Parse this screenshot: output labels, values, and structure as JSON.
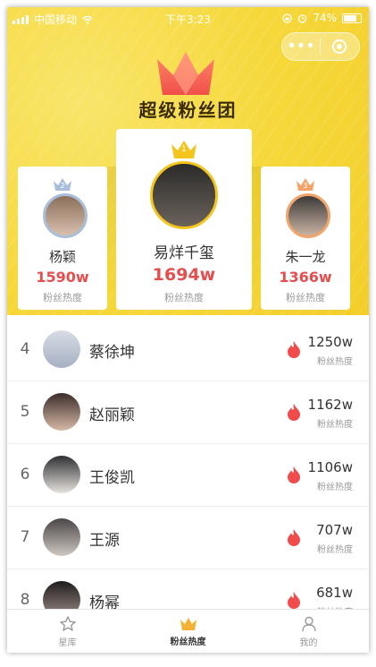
{
  "status_bar": {
    "carrier": "中国移动",
    "time": "下午3:23",
    "battery": "74%"
  },
  "header": {
    "title": "超级粉丝团"
  },
  "podium": [
    {
      "rank": "2",
      "name": "杨颖",
      "heat": "1590w",
      "heat_label": "粉丝热度"
    },
    {
      "rank": "1",
      "name": "易烊千玺",
      "heat": "1694w",
      "heat_label": "粉丝热度"
    },
    {
      "rank": "3",
      "name": "朱一龙",
      "heat": "1366w",
      "heat_label": "粉丝热度"
    }
  ],
  "list": [
    {
      "rank": "4",
      "name": "蔡徐坤",
      "heat": "1250w",
      "heat_label": "粉丝热度"
    },
    {
      "rank": "5",
      "name": "赵丽颖",
      "heat": "1162w",
      "heat_label": "粉丝热度"
    },
    {
      "rank": "6",
      "name": "王俊凯",
      "heat": "1106w",
      "heat_label": "粉丝热度"
    },
    {
      "rank": "7",
      "name": "王源",
      "heat": "707w",
      "heat_label": "粉丝热度"
    },
    {
      "rank": "8",
      "name": "杨幂",
      "heat": "681w",
      "heat_label": "粉丝热度"
    }
  ],
  "tabs": [
    {
      "label": "星库",
      "icon": "star-icon"
    },
    {
      "label": "粉丝热度",
      "icon": "crown-icon"
    },
    {
      "label": "我的",
      "icon": "user-icon"
    }
  ],
  "colors": {
    "accent": "#f6d83b",
    "heat": "#e84d4d",
    "flame": "#f24b4b"
  }
}
